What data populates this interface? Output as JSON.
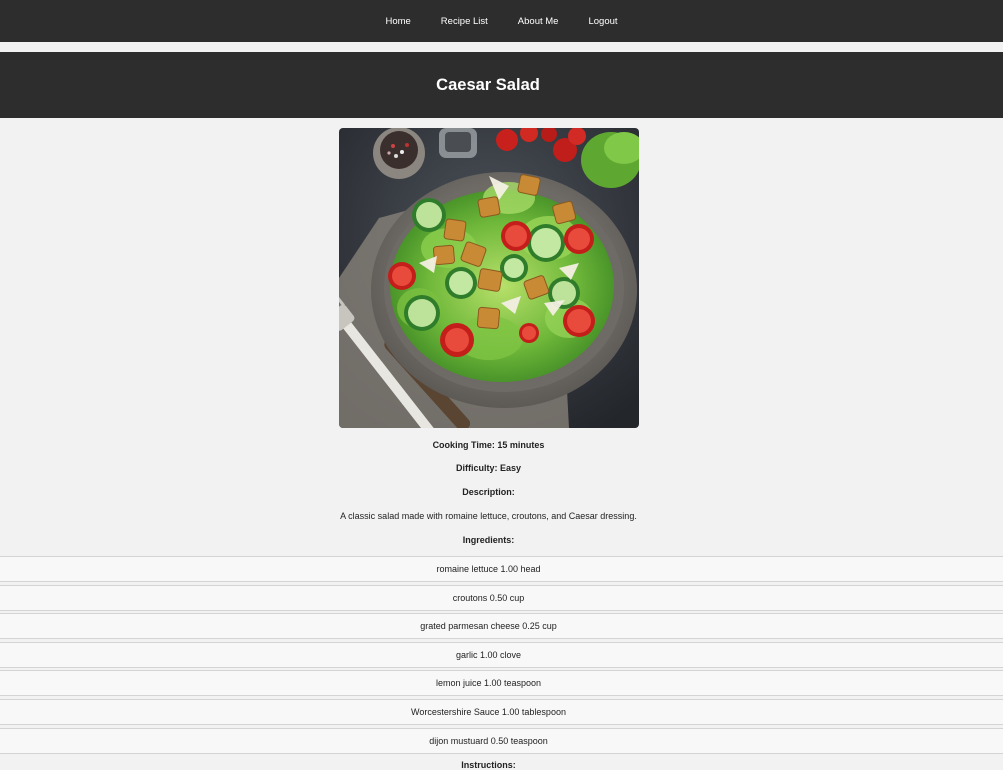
{
  "nav": {
    "items": [
      {
        "label": "Home"
      },
      {
        "label": "Recipe List"
      },
      {
        "label": "About Me"
      },
      {
        "label": "Logout"
      }
    ]
  },
  "recipe": {
    "title": "Caesar Salad",
    "cooking_time": "Cooking Time: 15 minutes",
    "difficulty": "Difficulty: Easy",
    "description_label": "Description:",
    "description": "A classic salad made with romaine lettuce, croutons, and Caesar dressing.",
    "ingredients_label": "Ingredients:",
    "ingredients": [
      "romaine lettuce 1.00 head",
      "croutons 0.50 cup",
      "grated parmesan cheese 0.25 cup",
      "garlic 1.00 clove",
      "lemon juice 1.00 teaspoon",
      "Worcestershire Sauce 1.00 tablespoon",
      "dijon mustuard 0.50 teaspoon"
    ],
    "instructions_label": "Instructions:"
  },
  "colors": {
    "header_bg": "#2d2d2d",
    "page_bg": "#f2f2f2",
    "row_bg": "#f8f8f8",
    "row_border": "#d4d4d4"
  }
}
